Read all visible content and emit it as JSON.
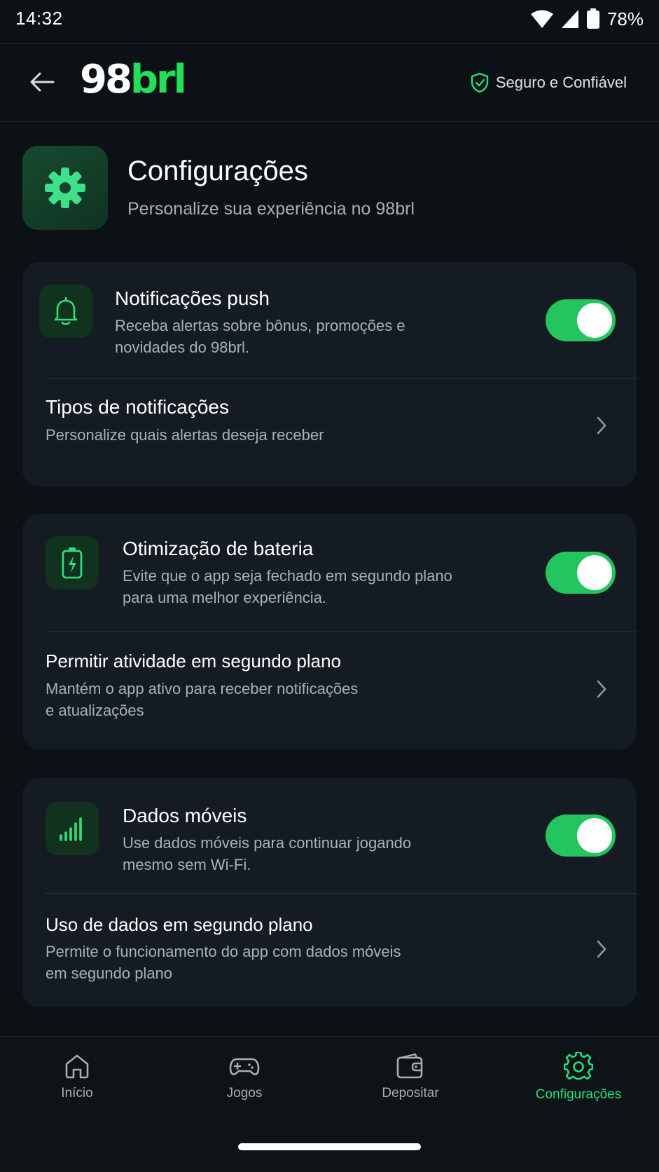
{
  "status_bar": {
    "time": "14:32",
    "battery_percent": "78%",
    "icons": [
      "wifi-icon",
      "cell-signal-icon",
      "battery-icon"
    ]
  },
  "header": {
    "back_icon": "arrow-left-icon",
    "logo": {
      "number": "98",
      "brand": "brl"
    },
    "trust_badge": {
      "icon": "shield-check-icon",
      "label": "Seguro e Confiável"
    }
  },
  "page": {
    "icon": "gear-icon",
    "title": "Configurações",
    "subtitle": "Personalize sua experiência no 98brl"
  },
  "sections": [
    {
      "toggle_row": {
        "icon": "bell-icon",
        "title": "Notificações push",
        "description_lines": [
          "Receba alertas sobre bônus, promoções e",
          "novidades do 98brl."
        ],
        "enabled": true
      },
      "link_row": {
        "title": "Tipos de notificações",
        "description_lines": [
          "Personalize quais alertas deseja receber"
        ]
      }
    },
    {
      "toggle_row": {
        "icon": "battery-charging-icon",
        "title": "Otimização de bateria",
        "description_lines": [
          "Evite que o app seja fechado em segundo plano",
          "para uma melhor experiência."
        ],
        "enabled": true
      },
      "link_row": {
        "title": "Permitir atividade em segundo plano",
        "description_lines": [
          "Mantém o app ativo para receber notificações",
          "e atualizações"
        ]
      }
    },
    {
      "toggle_row": {
        "icon": "signal-bars-icon",
        "title": "Dados móveis",
        "description_lines": [
          "Use dados móveis para continuar jogando",
          "mesmo sem Wi-Fi."
        ],
        "enabled": true
      },
      "link_row": {
        "title": "Uso de dados em segundo plano",
        "description_lines": [
          "Permite o funcionamento do app com dados móveis",
          "em segundo plano"
        ]
      }
    }
  ],
  "bottom_nav": {
    "items": [
      {
        "label": "Início",
        "icon": "home-icon",
        "active": false
      },
      {
        "label": "Jogos",
        "icon": "gamepad-icon",
        "active": false
      },
      {
        "label": "Depositar",
        "icon": "wallet-icon",
        "active": false
      },
      {
        "label": "Configurações",
        "icon": "gear-icon",
        "active": true
      }
    ]
  },
  "colors": {
    "accent": "#22e05a",
    "background": "#0c1116",
    "card": "#151b22",
    "toggle_on": "#22c55e"
  }
}
